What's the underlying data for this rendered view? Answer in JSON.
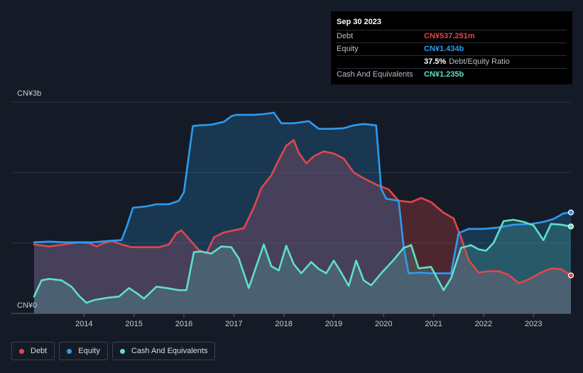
{
  "tooltip": {
    "date": "Sep 30 2023",
    "rows": [
      {
        "label": "Debt",
        "value": "CN¥537.251m",
        "suffix": "",
        "color": "#e0474c"
      },
      {
        "label": "Equity",
        "value": "CN¥1.434b",
        "suffix": "",
        "color": "#2e9bf0"
      },
      {
        "label": "",
        "value": "37.5%",
        "suffix": "Debt/Equity Ratio",
        "color": "#ffffff"
      },
      {
        "label": "Cash And Equivalents",
        "value": "CN¥1.235b",
        "suffix": "",
        "color": "#5ee0c9"
      }
    ]
  },
  "legend": [
    {
      "label": "Debt",
      "color": "#e0474c"
    },
    {
      "label": "Equity",
      "color": "#2e9bf0"
    },
    {
      "label": "Cash And Equivalents",
      "color": "#5ee0c9"
    }
  ],
  "chart_data": {
    "type": "area",
    "title": "",
    "xlabel": "",
    "ylabel": "",
    "y_tick_labels": [
      "CN¥3b",
      "CN¥0"
    ],
    "ylim": [
      0,
      3.0
    ],
    "xlim": [
      2013.0,
      2023.75
    ],
    "x_ticks": [
      2014,
      2015,
      2016,
      2017,
      2018,
      2019,
      2020,
      2021,
      2022,
      2023
    ],
    "unit": "CN¥ billions",
    "grid": true,
    "legend_position": "bottom-left",
    "series": [
      {
        "name": "Debt",
        "color": "#e0474c",
        "points": [
          [
            2013.0,
            0.98
          ],
          [
            2013.3,
            0.95
          ],
          [
            2013.6,
            0.98
          ],
          [
            2013.9,
            1.01
          ],
          [
            2014.1,
            1.0
          ],
          [
            2014.25,
            0.95
          ],
          [
            2014.4,
            1.0
          ],
          [
            2014.55,
            1.03
          ],
          [
            2014.75,
            0.98
          ],
          [
            2014.95,
            0.94
          ],
          [
            2015.3,
            0.94
          ],
          [
            2015.5,
            0.94
          ],
          [
            2015.7,
            0.98
          ],
          [
            2015.85,
            1.14
          ],
          [
            2015.95,
            1.18
          ],
          [
            2016.1,
            1.06
          ],
          [
            2016.3,
            0.9
          ],
          [
            2016.45,
            0.85
          ],
          [
            2016.6,
            1.08
          ],
          [
            2016.8,
            1.15
          ],
          [
            2017.0,
            1.18
          ],
          [
            2017.2,
            1.21
          ],
          [
            2017.4,
            1.5
          ],
          [
            2017.55,
            1.78
          ],
          [
            2017.75,
            1.96
          ],
          [
            2017.9,
            2.18
          ],
          [
            2018.05,
            2.38
          ],
          [
            2018.2,
            2.46
          ],
          [
            2018.3,
            2.28
          ],
          [
            2018.45,
            2.13
          ],
          [
            2018.6,
            2.23
          ],
          [
            2018.8,
            2.3
          ],
          [
            2019.0,
            2.27
          ],
          [
            2019.2,
            2.2
          ],
          [
            2019.4,
            2.0
          ],
          [
            2019.6,
            1.92
          ],
          [
            2019.85,
            1.83
          ],
          [
            2020.1,
            1.76
          ],
          [
            2020.3,
            1.6
          ],
          [
            2020.55,
            1.58
          ],
          [
            2020.75,
            1.64
          ],
          [
            2020.95,
            1.58
          ],
          [
            2021.2,
            1.43
          ],
          [
            2021.4,
            1.35
          ],
          [
            2021.55,
            1.08
          ],
          [
            2021.7,
            0.76
          ],
          [
            2021.9,
            0.58
          ],
          [
            2022.1,
            0.6
          ],
          [
            2022.3,
            0.6
          ],
          [
            2022.5,
            0.55
          ],
          [
            2022.7,
            0.43
          ],
          [
            2022.9,
            0.48
          ],
          [
            2023.15,
            0.58
          ],
          [
            2023.35,
            0.64
          ],
          [
            2023.55,
            0.63
          ],
          [
            2023.75,
            0.54
          ]
        ]
      },
      {
        "name": "Equity",
        "color": "#2e9bf0",
        "points": [
          [
            2013.0,
            1.01
          ],
          [
            2013.3,
            1.02
          ],
          [
            2013.6,
            1.01
          ],
          [
            2013.9,
            1.01
          ],
          [
            2014.2,
            1.01
          ],
          [
            2014.5,
            1.03
          ],
          [
            2014.75,
            1.04
          ],
          [
            2014.85,
            1.22
          ],
          [
            2014.98,
            1.5
          ],
          [
            2015.25,
            1.52
          ],
          [
            2015.45,
            1.55
          ],
          [
            2015.7,
            1.55
          ],
          [
            2015.9,
            1.6
          ],
          [
            2016.0,
            1.72
          ],
          [
            2016.1,
            2.25
          ],
          [
            2016.18,
            2.66
          ],
          [
            2016.3,
            2.67
          ],
          [
            2016.55,
            2.68
          ],
          [
            2016.8,
            2.72
          ],
          [
            2016.95,
            2.8
          ],
          [
            2017.05,
            2.82
          ],
          [
            2017.4,
            2.82
          ],
          [
            2017.6,
            2.83
          ],
          [
            2017.8,
            2.85
          ],
          [
            2017.95,
            2.7
          ],
          [
            2018.2,
            2.7
          ],
          [
            2018.5,
            2.73
          ],
          [
            2018.7,
            2.62
          ],
          [
            2018.95,
            2.62
          ],
          [
            2019.2,
            2.63
          ],
          [
            2019.4,
            2.67
          ],
          [
            2019.6,
            2.69
          ],
          [
            2019.85,
            2.67
          ],
          [
            2019.95,
            1.77
          ],
          [
            2020.05,
            1.63
          ],
          [
            2020.3,
            1.6
          ],
          [
            2020.4,
            0.95
          ],
          [
            2020.5,
            0.57
          ],
          [
            2020.7,
            0.58
          ],
          [
            2020.95,
            0.57
          ],
          [
            2021.2,
            0.57
          ],
          [
            2021.35,
            0.57
          ],
          [
            2021.5,
            1.14
          ],
          [
            2021.7,
            1.2
          ],
          [
            2022.0,
            1.2
          ],
          [
            2022.3,
            1.22
          ],
          [
            2022.6,
            1.26
          ],
          [
            2022.95,
            1.27
          ],
          [
            2023.2,
            1.3
          ],
          [
            2023.4,
            1.34
          ],
          [
            2023.6,
            1.42
          ],
          [
            2023.75,
            1.434
          ]
        ]
      },
      {
        "name": "Cash And Equivalents",
        "color": "#5ee0c9",
        "points": [
          [
            2013.0,
            0.24
          ],
          [
            2013.15,
            0.47
          ],
          [
            2013.3,
            0.49
          ],
          [
            2013.55,
            0.47
          ],
          [
            2013.75,
            0.38
          ],
          [
            2013.9,
            0.25
          ],
          [
            2014.05,
            0.15
          ],
          [
            2014.2,
            0.19
          ],
          [
            2014.45,
            0.22
          ],
          [
            2014.7,
            0.24
          ],
          [
            2014.9,
            0.36
          ],
          [
            2015.05,
            0.29
          ],
          [
            2015.2,
            0.21
          ],
          [
            2015.45,
            0.38
          ],
          [
            2015.65,
            0.36
          ],
          [
            2015.9,
            0.33
          ],
          [
            2016.05,
            0.33
          ],
          [
            2016.2,
            0.87
          ],
          [
            2016.35,
            0.88
          ],
          [
            2016.55,
            0.85
          ],
          [
            2016.75,
            0.95
          ],
          [
            2016.95,
            0.94
          ],
          [
            2017.1,
            0.78
          ],
          [
            2017.3,
            0.36
          ],
          [
            2017.45,
            0.67
          ],
          [
            2017.6,
            0.98
          ],
          [
            2017.75,
            0.67
          ],
          [
            2017.9,
            0.61
          ],
          [
            2018.05,
            0.96
          ],
          [
            2018.2,
            0.7
          ],
          [
            2018.35,
            0.57
          ],
          [
            2018.55,
            0.73
          ],
          [
            2018.7,
            0.63
          ],
          [
            2018.85,
            0.57
          ],
          [
            2019.0,
            0.75
          ],
          [
            2019.15,
            0.58
          ],
          [
            2019.3,
            0.39
          ],
          [
            2019.45,
            0.75
          ],
          [
            2019.6,
            0.47
          ],
          [
            2019.75,
            0.4
          ],
          [
            2019.95,
            0.57
          ],
          [
            2020.2,
            0.76
          ],
          [
            2020.4,
            0.93
          ],
          [
            2020.55,
            0.97
          ],
          [
            2020.7,
            0.64
          ],
          [
            2020.95,
            0.66
          ],
          [
            2021.2,
            0.33
          ],
          [
            2021.35,
            0.5
          ],
          [
            2021.55,
            0.93
          ],
          [
            2021.75,
            0.97
          ],
          [
            2021.9,
            0.91
          ],
          [
            2022.05,
            0.89
          ],
          [
            2022.2,
            1.0
          ],
          [
            2022.4,
            1.31
          ],
          [
            2022.6,
            1.33
          ],
          [
            2022.8,
            1.3
          ],
          [
            2023.0,
            1.25
          ],
          [
            2023.2,
            1.04
          ],
          [
            2023.35,
            1.27
          ],
          [
            2023.55,
            1.26
          ],
          [
            2023.75,
            1.235
          ]
        ]
      }
    ]
  }
}
